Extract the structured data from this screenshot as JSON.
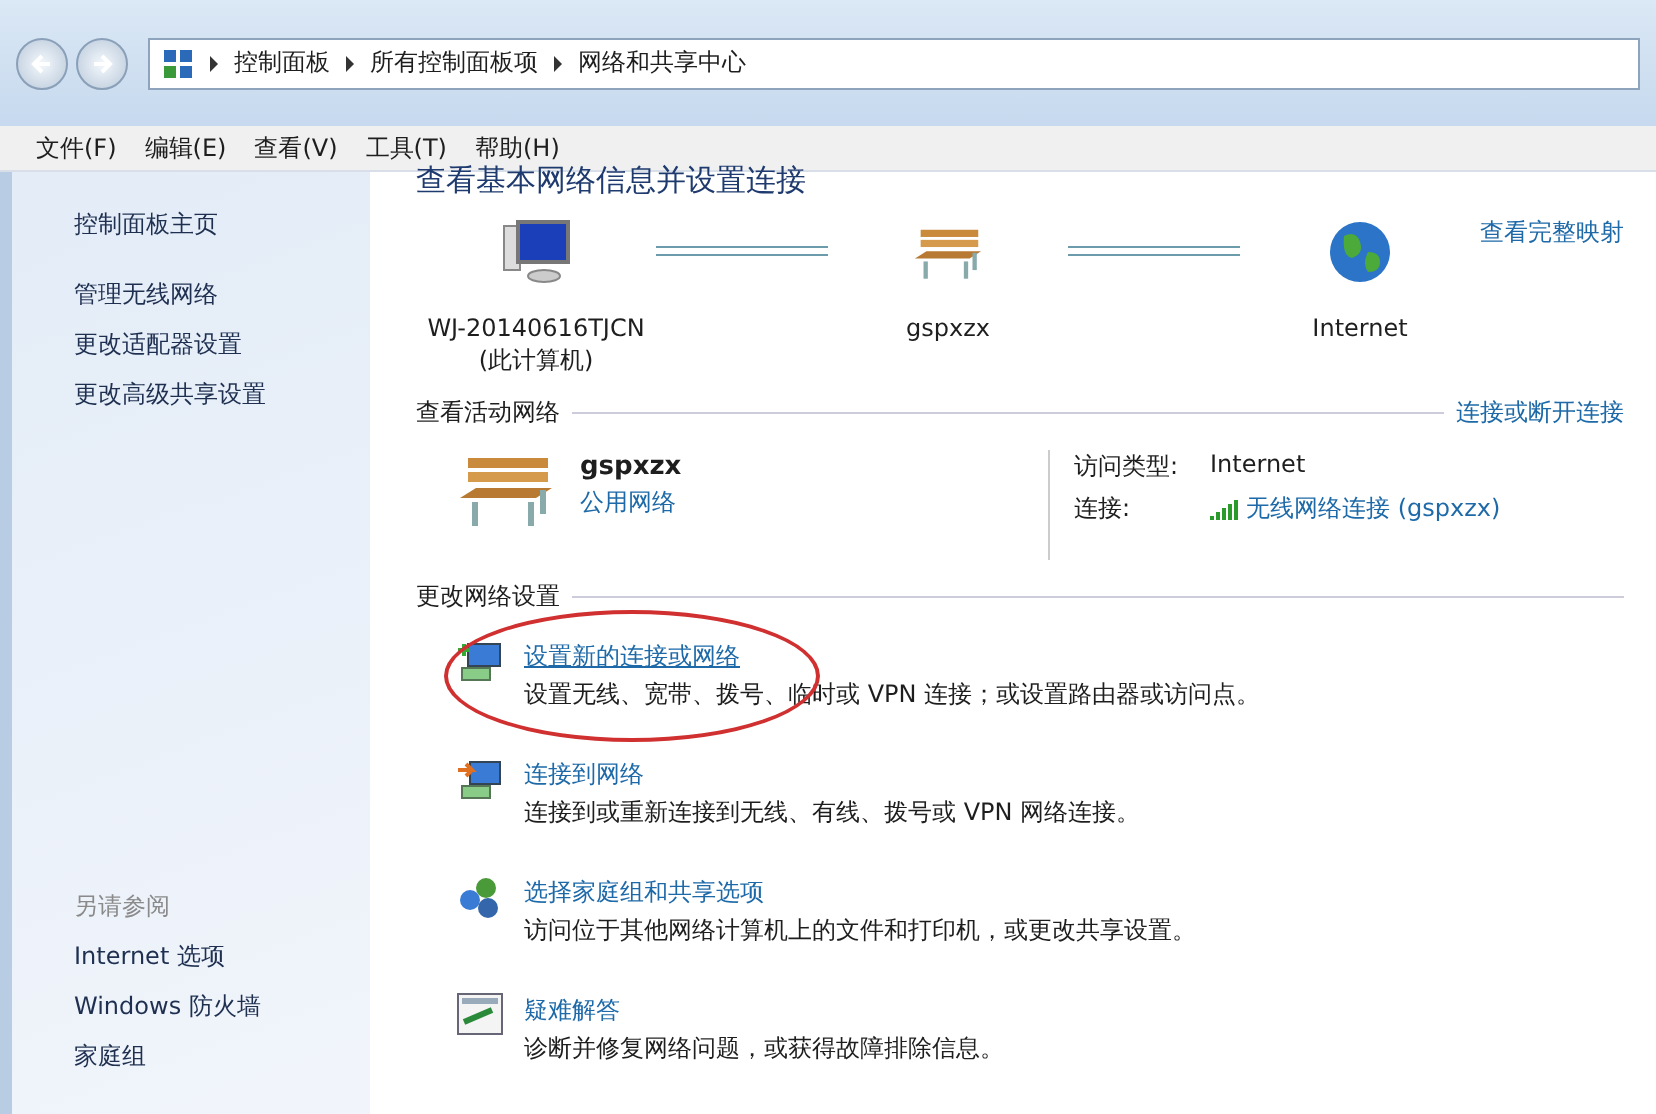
{
  "address_bar": {
    "path": [
      "控制面板",
      "所有控制面板项",
      "网络和共享中心"
    ]
  },
  "menu": [
    "文件(F)",
    "编辑(E)",
    "查看(V)",
    "工具(T)",
    "帮助(H)"
  ],
  "sidebar": {
    "items": [
      "控制面板主页",
      "管理无线网络",
      "更改适配器设置",
      "更改高级共享设置"
    ],
    "see_also": {
      "title": "另请参阅",
      "items": [
        "Internet 选项",
        "Windows 防火墙",
        "家庭组"
      ]
    }
  },
  "main": {
    "title": "查看基本网络信息并设置连接",
    "view_full_map": "查看完整映射",
    "network_map": [
      {
        "kind": "computer",
        "label": "WJ-20140616TJCN",
        "sublabel": "(此计算机)"
      },
      {
        "kind": "network",
        "label": "gspxzx"
      },
      {
        "kind": "internet",
        "label": "Internet"
      }
    ],
    "active_networks": {
      "title": "查看活动网络",
      "link": "连接或断开连接",
      "name": "gspxzx",
      "category": "公用网络",
      "access_type_label": "访问类型:",
      "access_type": "Internet",
      "connection_label": "连接:",
      "connection": "无线网络连接 (gspxzx)"
    },
    "change_settings": {
      "title": "更改网络设置",
      "tasks": [
        {
          "kind": "new_connection",
          "title": "设置新的连接或网络",
          "description": "设置无线、宽带、拨号、临时或 VPN 连接；或设置路由器或访问点。",
          "circled": true
        },
        {
          "kind": "connect",
          "title": "连接到网络",
          "description": "连接到或重新连接到无线、有线、拨号或 VPN 网络连接。",
          "circled": false
        },
        {
          "kind": "homegroup",
          "title": "选择家庭组和共享选项",
          "description": "访问位于其他网络计算机上的文件和打印机，或更改共享设置。",
          "circled": false
        },
        {
          "kind": "troubleshoot",
          "title": "疑难解答",
          "description": "诊断并修复网络问题，或获得故障排除信息。",
          "circled": false
        }
      ]
    }
  }
}
